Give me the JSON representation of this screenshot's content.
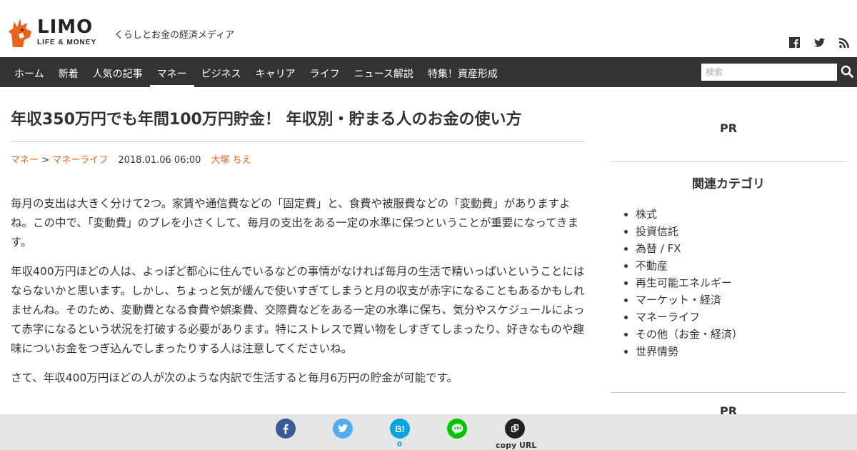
{
  "header": {
    "logo_text": "LIMO",
    "logo_sub": "LIFE & MONEY",
    "tagline": "くらしとお金の経済メディア",
    "social": [
      "facebook-icon",
      "twitter-icon",
      "rss-icon"
    ]
  },
  "nav": {
    "items": [
      "ホーム",
      "新着",
      "人気の記事",
      "マネー",
      "ビジネス",
      "キャリア",
      "ライフ",
      "ニュース解説",
      "特集！資産形成"
    ],
    "active": "マネー"
  },
  "search": {
    "placeholder": "検索"
  },
  "article": {
    "title": "年収350万円でも年間100万円貯金！ 年収別・貯まる人のお金の使い方",
    "breadcrumb_category": "マネー",
    "breadcrumb_sep": ">",
    "breadcrumb_subcategory": "マネーライフ",
    "date": "2018.01.06 06:00",
    "author": "大塚 ちえ",
    "paragraphs": [
      "毎月の支出は大きく分けて2つ。家賃や通信費などの「固定費」と、食費や被服費などの「変動費」がありますよね。この中で、「変動費」のブレを小さくして、毎月の支出をある一定の水準に保つということが重要になってきます。",
      "年収400万円ほどの人は、よっぽど都心に住んでいるなどの事情がなければ毎月の生活で精いっぱいということにはならないかと思います。しかし、ちょっと気が緩んで使いすぎてしまうと月の収支が赤字になることもあるかもしれませんね。そのため、変動費となる食費や娯楽費、交際費などをある一定の水準に保ち、気分やスケジュールによって赤字になるという状況を打破する必要があります。特にストレスで買い物をしすぎてしまったり、好きなものや趣味についお金をつぎ込んでしまったりする人は注意してくださいね。",
      "さて、年収400万円ほどの人が次のような内訳で生活すると毎月6万円の貯金が可能です。"
    ]
  },
  "sidebar": {
    "pr_label": "PR",
    "related_heading": "関連カテゴリ",
    "categories": [
      "株式",
      "投資信託",
      "為替 / FX",
      "不動産",
      "再生可能エネルギー",
      "マーケット・経済",
      "マネーライフ",
      "その他（お金・経済）",
      "世界情勢"
    ],
    "pr_label_2": "PR"
  },
  "share_bar": {
    "hatena_label": "B!",
    "hatena_count": "0",
    "copy_url_label": "copy URL"
  },
  "colors": {
    "nav_bg": "#333333",
    "accent_link": "#e8641b",
    "facebook": "#3b5998",
    "twitter": "#55acee",
    "hatena": "#00a4de",
    "line": "#00c300"
  }
}
